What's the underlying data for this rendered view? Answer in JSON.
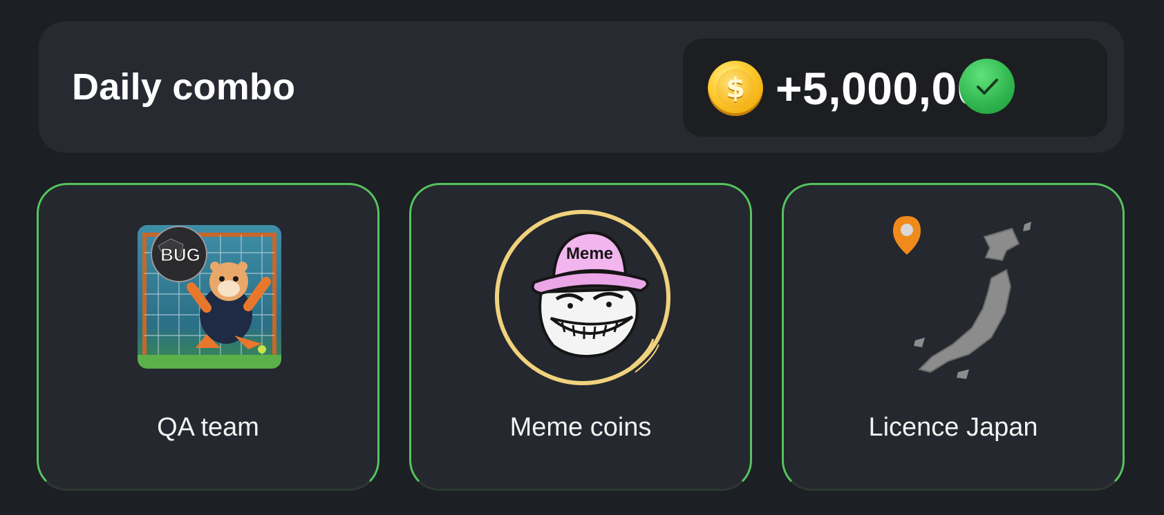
{
  "header": {
    "title": "Daily combo",
    "reward_amount": "+5,000,000",
    "coin_symbol": "$",
    "coin_icon": "coin-icon",
    "status_icon": "checkmark-icon"
  },
  "colors": {
    "background": "#1c1f24",
    "panel": "#272a30",
    "card_border": "#56c35f",
    "check_green": "#2fb44e",
    "coin_gold": "#f6b81e"
  },
  "cards": [
    {
      "label": "QA team",
      "image_badge_text": "BUG",
      "icon": "hamster-goalkeeper-image"
    },
    {
      "label": "Meme coins",
      "image_hat_text": "Meme",
      "icon": "trollface-meme-image"
    },
    {
      "label": "Licence Japan",
      "icon": "japan-map-image"
    }
  ]
}
